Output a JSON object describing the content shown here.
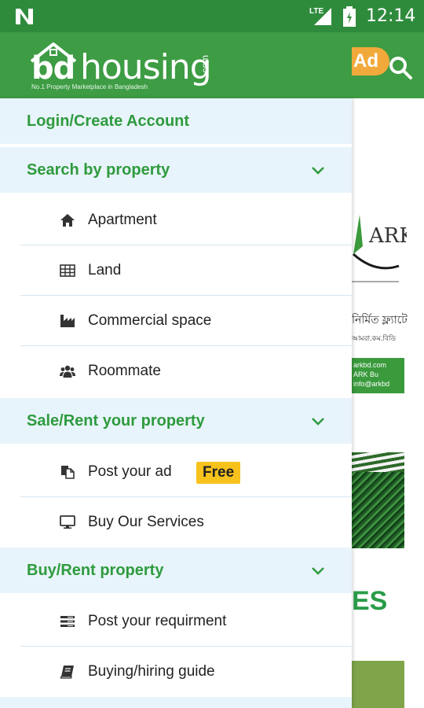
{
  "status_bar": {
    "network": "LTE",
    "time": "12:14"
  },
  "app_bar": {
    "logo_bd": "bd",
    "logo_housing": "housing",
    "logo_com": ".com",
    "logo_tagline": "No.1 Property Marketplace in Bangladesh",
    "ad_badge": "Ad",
    "search_icon": "search-icon"
  },
  "background_page": {
    "ark_text": "ARK",
    "bangla_text_1": "নির্মিত ফ্ল্যাটে",
    "bangla_text_2": "আমরা.কম.বিডি",
    "green_box_lines": [
      "arkbd.com",
      "ARK Bu",
      "info@arkbd"
    ],
    "heading_fragment": "ES"
  },
  "drawer": {
    "login": "Login/Create Account",
    "sections": [
      {
        "label": "Search by property",
        "items": [
          {
            "label": "Apartment",
            "icon": "home-icon"
          },
          {
            "label": "Land",
            "icon": "grid-icon"
          },
          {
            "label": "Commercial space",
            "icon": "industry-icon"
          },
          {
            "label": "Roommate",
            "icon": "users-icon"
          }
        ]
      },
      {
        "label": "Sale/Rent your property",
        "items": [
          {
            "label": "Post your ad",
            "icon": "copy-icon",
            "badge": "Free"
          },
          {
            "label": "Buy Our Services",
            "icon": "monitor-icon"
          }
        ]
      },
      {
        "label": "Buy/Rent property",
        "items": [
          {
            "label": "Post your requirment",
            "icon": "list-icon"
          },
          {
            "label": "Buying/hiring guide",
            "icon": "book-icon"
          }
        ]
      }
    ]
  },
  "colors": {
    "status_bar": "#2e8b3c",
    "app_bar": "#3d9c44",
    "section_bg": "#e8f4fb",
    "section_text": "#2e9b3e",
    "free_badge": "#f8c21c",
    "ad_badge": "#f2a93b"
  }
}
